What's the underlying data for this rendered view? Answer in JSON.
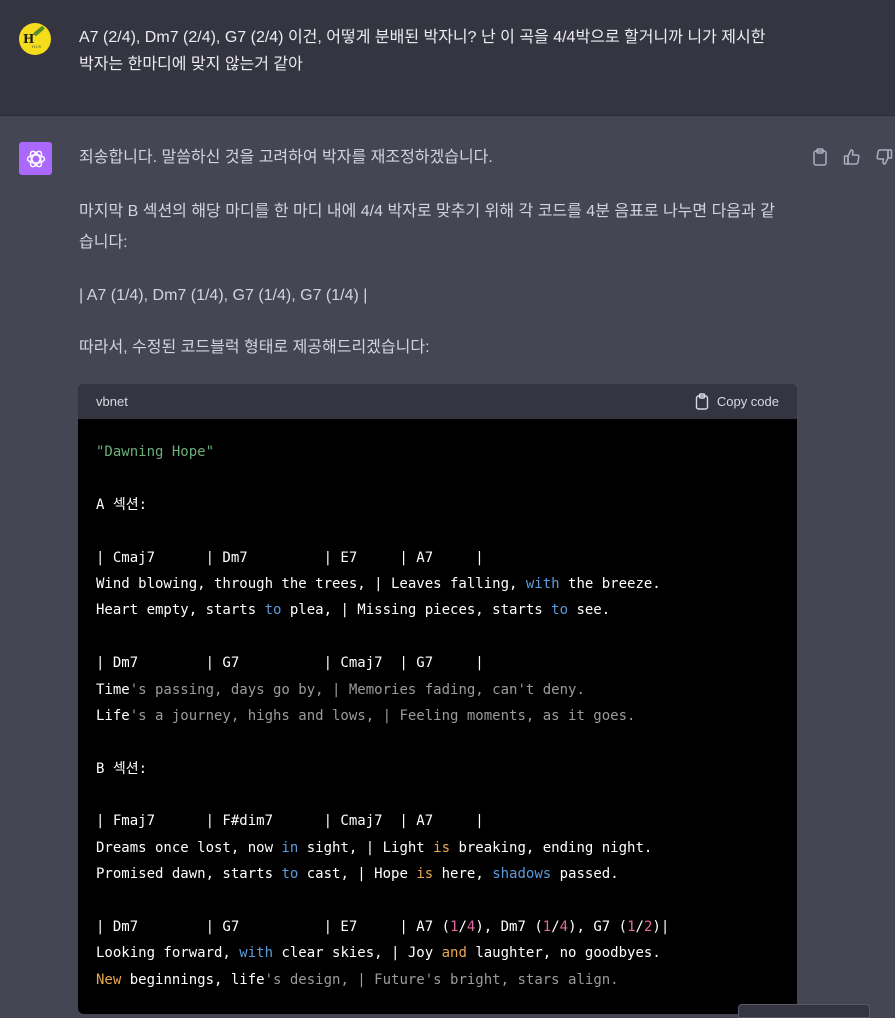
{
  "user_message": {
    "line1": "A7 (2/4), Dm7 (2/4), G7 (2/4) 이건, 어떻게 분배된 박자니? 난 이 곡을 4/4박으로 할거니까 니가 제시한",
    "line2": "박자는 한마디에 맞지 않는거 같아"
  },
  "assistant": {
    "p1": "죄송합니다. 말씀하신 것을 고려하여 박자를 재조정하겠습니다.",
    "p2a": "마지막 B 섹션의 해당 마디를 한 마디 내에 4/4 박자로 맞추기 위해 각 코드를 4분 음표로 나누면 다음과 같",
    "p2b": "습니다:",
    "p3": "| A7 (1/4), Dm7 (1/4), G7 (1/4), G7 (1/4) |",
    "p4": "따라서, 수정된 코드블럭 형태로 제공해드리겠습니다:"
  },
  "code_block": {
    "language": "vbnet",
    "copy_label": "Copy code",
    "lines": [
      [
        {
          "t": "\"Dawning Hope\"",
          "c": "str"
        }
      ],
      [],
      [
        {
          "t": "A 섹션:"
        }
      ],
      [],
      [
        {
          "t": "| Cmaj7      | Dm7         | E7     | A7     |"
        }
      ],
      [
        {
          "t": "Wind blowing, through the trees, | Leaves falling, "
        },
        {
          "t": "with",
          "c": "kw"
        },
        {
          "t": " the breeze."
        }
      ],
      [
        {
          "t": "Heart empty, starts "
        },
        {
          "t": "to",
          "c": "kw"
        },
        {
          "t": " plea, | Missing pieces, starts "
        },
        {
          "t": "to",
          "c": "kw"
        },
        {
          "t": " see."
        }
      ],
      [],
      [
        {
          "t": "| Dm7        | G7          | Cmaj7  | G7     |"
        }
      ],
      [
        {
          "t": "Time"
        },
        {
          "t": "'s passing, days go by, | Memories fading, can't deny.",
          "c": "gray"
        }
      ],
      [
        {
          "t": "Life"
        },
        {
          "t": "'s a journey, highs and lows, | Feeling moments, as it goes.",
          "c": "gray"
        }
      ],
      [],
      [
        {
          "t": "B 섹션:"
        }
      ],
      [],
      [
        {
          "t": "| Fmaj7      | F#dim7      | Cmaj7  | A7     |"
        }
      ],
      [
        {
          "t": "Dreams once lost, now "
        },
        {
          "t": "in",
          "c": "kw"
        },
        {
          "t": " sight, | Light "
        },
        {
          "t": "is",
          "c": "op"
        },
        {
          "t": " breaking, ending night."
        }
      ],
      [
        {
          "t": "Promised dawn, starts "
        },
        {
          "t": "to",
          "c": "kw"
        },
        {
          "t": " cast, | Hope "
        },
        {
          "t": "is",
          "c": "op"
        },
        {
          "t": " here, "
        },
        {
          "t": "shadows",
          "c": "kw"
        },
        {
          "t": " passed."
        }
      ],
      [],
      [
        {
          "t": "| Dm7        | G7          | E7     | A7 ("
        },
        {
          "t": "1",
          "c": "num"
        },
        {
          "t": "/"
        },
        {
          "t": "4",
          "c": "num"
        },
        {
          "t": "), Dm7 ("
        },
        {
          "t": "1",
          "c": "num"
        },
        {
          "t": "/"
        },
        {
          "t": "4",
          "c": "num"
        },
        {
          "t": "), G7 ("
        },
        {
          "t": "1",
          "c": "num"
        },
        {
          "t": "/"
        },
        {
          "t": "2",
          "c": "num"
        },
        {
          "t": ")|"
        }
      ],
      [
        {
          "t": "Looking forward, "
        },
        {
          "t": "with",
          "c": "kw"
        },
        {
          "t": " clear skies, | Joy "
        },
        {
          "t": "and",
          "c": "op"
        },
        {
          "t": " laughter, no goodbyes."
        }
      ],
      [
        {
          "t": "New",
          "c": "op"
        },
        {
          "t": " beginnings, life"
        },
        {
          "t": "'s design, | Future's bright, stars align.",
          "c": "gray"
        }
      ]
    ]
  },
  "icons": {
    "user_avatar": "user-avatar-icon",
    "assistant_avatar": "chatgpt-logo-icon",
    "copy": "clipboard-icon",
    "thumbs_up": "thumbs-up-icon",
    "thumbs_down": "thumbs-down-icon"
  },
  "colors": {
    "page_bg": "#343541",
    "assistant_bg": "#444654",
    "assistant_avatar_bg": "#ab68ff",
    "code_bg": "#000000",
    "code_string": "#6cad78",
    "code_keyword": "#5b9bdc",
    "code_number": "#e06c9f",
    "code_operator": "#e9a74f"
  }
}
